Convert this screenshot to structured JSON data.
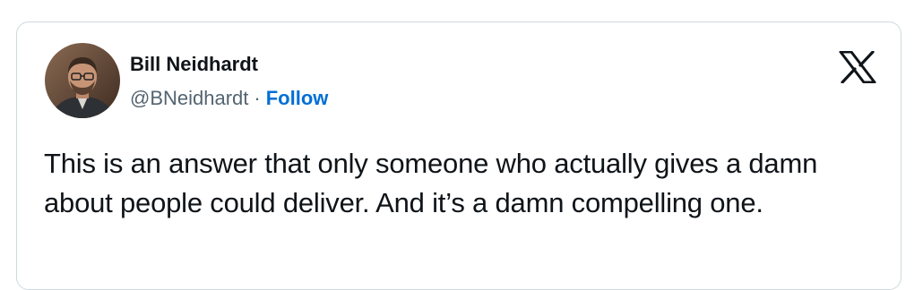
{
  "tweet": {
    "author_name": "Bill Neidhardt",
    "handle": "@BNeidhardt",
    "separator": "·",
    "follow_label": "Follow",
    "text": "This is an answer that only someone who actually gives a damn about people could deliver. And it’s a damn compelling one."
  },
  "icons": {
    "brand": "x-logo-icon",
    "avatar": "profile-photo"
  },
  "colors": {
    "follow": "#006fd6",
    "handle": "#536471",
    "text": "#0f1419",
    "border": "#cfd9de"
  }
}
